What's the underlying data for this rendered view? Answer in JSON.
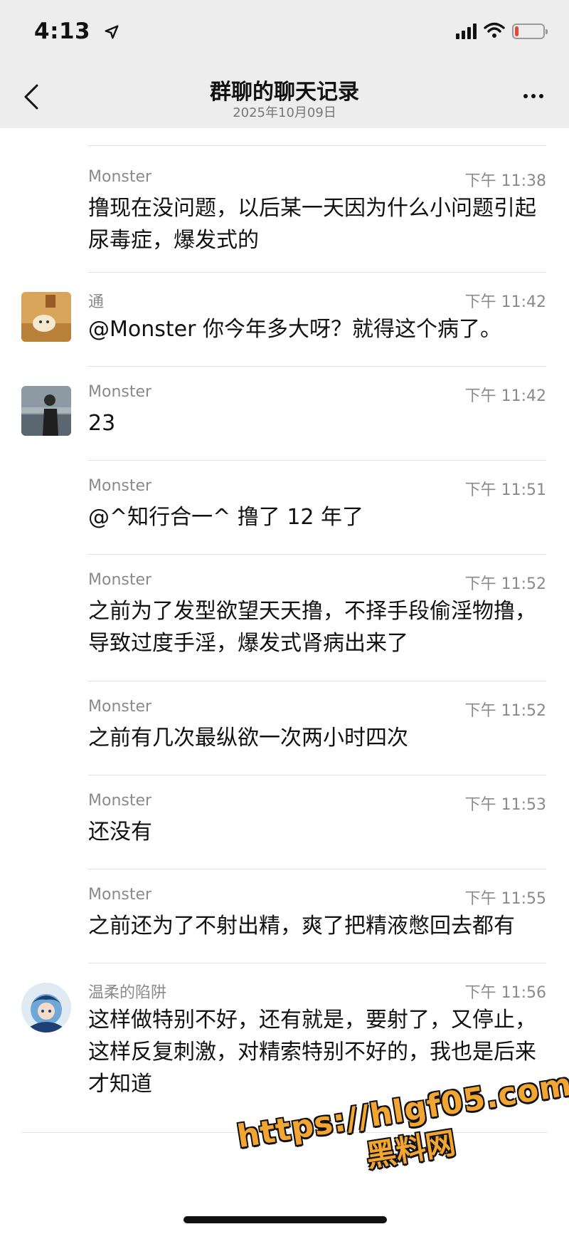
{
  "status_bar": {
    "time": "4:13",
    "icons": [
      "location-arrow-icon",
      "signal-icon",
      "wifi-icon",
      "battery-icon"
    ],
    "battery_level": 0.12,
    "battery_color": "#e8453c"
  },
  "nav": {
    "title": "群聊的聊天记录",
    "subtitle": "2025年10月09日",
    "back_icon": "chevron-left-icon",
    "more_icon": "more-dots-icon"
  },
  "messages": [
    {
      "sender": "Monster",
      "time": "下午 11:38",
      "text": "撸现在没问题，以后某一天因为什么小问题引起尿毒症，爆发式的",
      "avatar": null
    },
    {
      "sender": "通",
      "time": "下午 11:42",
      "text": "@Monster 你今年多大呀？就得这个病了。",
      "avatar": "cat-avatar"
    },
    {
      "sender": "Monster",
      "time": "下午 11:42",
      "text": "23",
      "avatar": "person-avatar"
    },
    {
      "sender": "Monster",
      "time": "下午 11:51",
      "text": "@^知行合一^ 撸了 12 年了",
      "avatar": null
    },
    {
      "sender": "Monster",
      "time": "下午 11:52",
      "text": "之前为了发型欲望天天撸，不择手段偷淫物撸，导致过度手淫，爆发式肾病出来了",
      "avatar": null
    },
    {
      "sender": "Monster",
      "time": "下午 11:52",
      "text": "之前有几次最纵欲一次两小时四次",
      "avatar": null
    },
    {
      "sender": "Monster",
      "time": "下午 11:53",
      "text": "还没有",
      "avatar": null
    },
    {
      "sender": "Monster",
      "time": "下午 11:55",
      "text": "之前还为了不射出精，爽了把精液憋回去都有",
      "avatar": null
    },
    {
      "sender": "温柔的陷阱",
      "time": "下午 11:56",
      "text": "这样做特别不好，还有就是，要射了，又停止，这样反复刺激，对精索特别不好的，我也是后来才知道",
      "avatar": "anime-avatar"
    }
  ],
  "watermark": {
    "url": "https://hlgf05.com",
    "name": "黑料网"
  }
}
